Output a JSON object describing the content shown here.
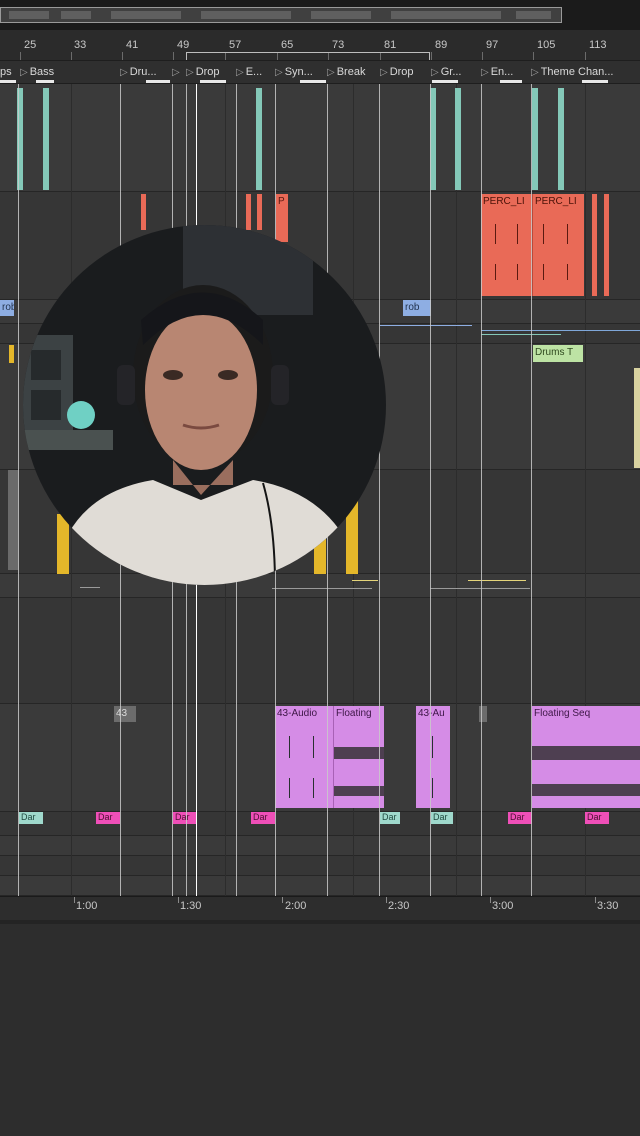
{
  "app": {
    "name": "Arrangement View"
  },
  "ruler": {
    "bar_numbers": [
      "25",
      "33",
      "41",
      "49",
      "57",
      "65",
      "73",
      "81",
      "89",
      "97",
      "105",
      "113"
    ]
  },
  "markers": [
    {
      "label": "ps"
    },
    {
      "label": "Bass"
    },
    {
      "label": "Dru..."
    },
    {
      "label": "Drop"
    },
    {
      "label": "E..."
    },
    {
      "label": "Syn..."
    },
    {
      "label": "Break"
    },
    {
      "label": "Drop"
    },
    {
      "label": "Gr..."
    },
    {
      "label": "En..."
    },
    {
      "label": "Theme Chan..."
    }
  ],
  "clips": {
    "perc_1": "PERC_LI",
    "perc_2": "PERC_LI",
    "perc_3": "P",
    "robo_1": "rob",
    "robo_2": "rob",
    "drums_t": "Drums T",
    "audio_43a": "43-Audio",
    "floating_a": "Floating",
    "audio_43b": "43-Au",
    "floating_seq": "Floating Seq",
    "small_43": "43",
    "c1": "Dar",
    "c2": "Dar",
    "c3": "Dar",
    "c4": "Dar",
    "c5": "Dar",
    "c6": "Dar",
    "c7": "Dar",
    "c8": "Dar",
    "c9": "Dar"
  },
  "timeline": {
    "labels": [
      "1:00",
      "1:30",
      "2:00",
      "2:30",
      "3:00",
      "3:30"
    ]
  },
  "colors": {
    "teal": "#84c8b8",
    "perc_red": "#e96a57",
    "audio_violet": "#d58ce6",
    "yellow": "#e4b72a",
    "pink": "#ef4fb8",
    "label_blue": "#8eaee3",
    "label_green": "#bde3a4"
  },
  "icons": {
    "marker_flag": "play-triangle-icon"
  }
}
